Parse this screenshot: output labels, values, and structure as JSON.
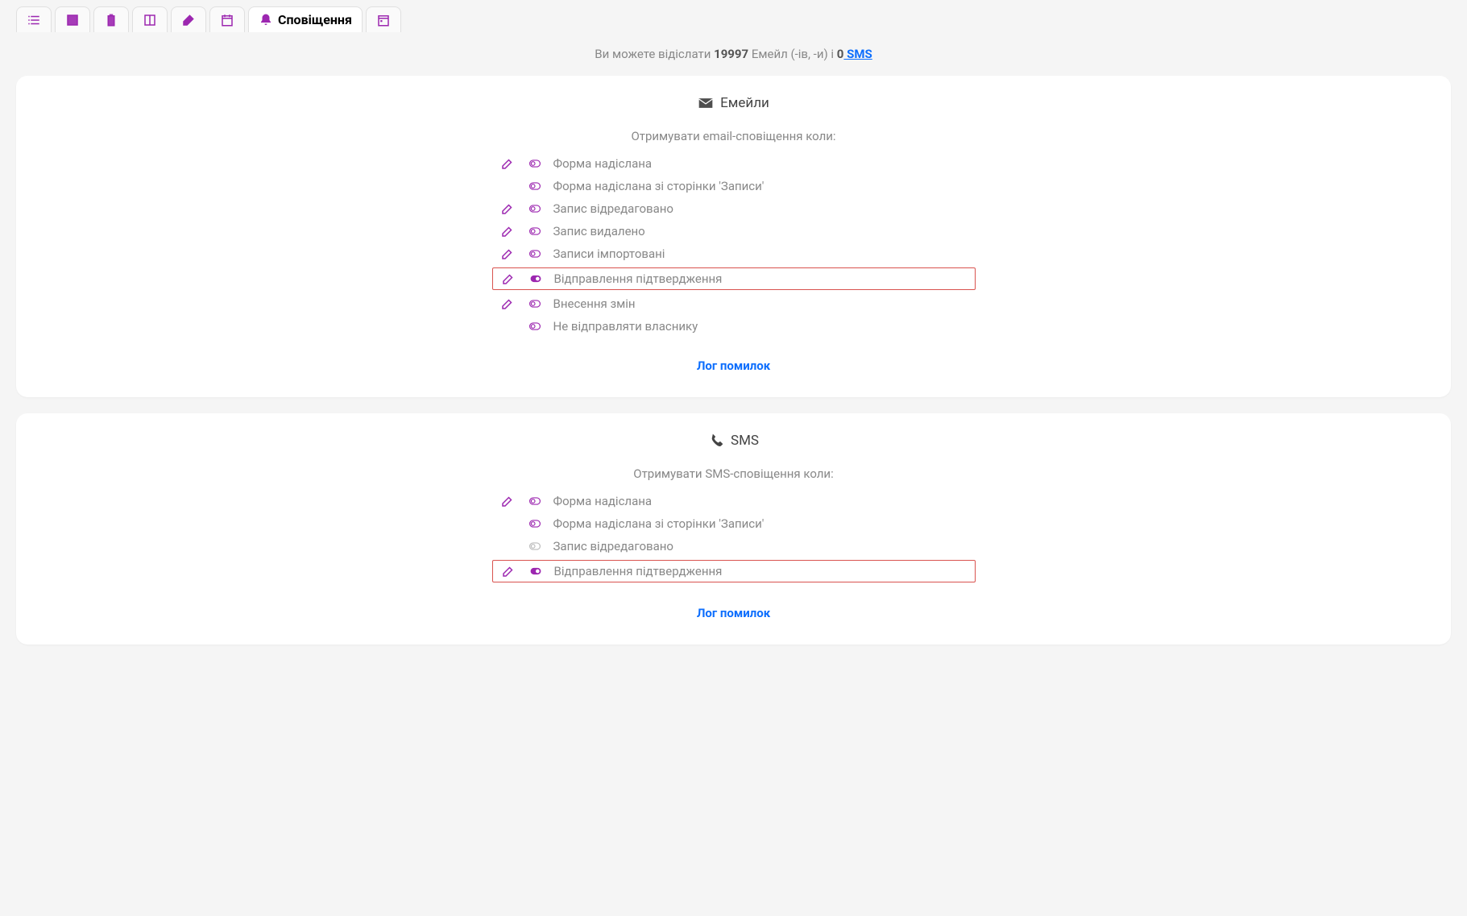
{
  "tabs": {
    "active_index": 6,
    "items": [
      {
        "icon": "list"
      },
      {
        "icon": "window"
      },
      {
        "icon": "clipboard"
      },
      {
        "icon": "columns"
      },
      {
        "icon": "paint"
      },
      {
        "icon": "calendar"
      },
      {
        "icon": "bell",
        "label": "Сповіщення"
      },
      {
        "icon": "date"
      }
    ]
  },
  "quota": {
    "prefix": "Ви можете відіслати ",
    "email_count": "19997",
    "email_label": " Емейл (-ів, -и) і ",
    "sms_count": "0",
    "sms_label": " SMS"
  },
  "email_panel": {
    "title": "Емейли",
    "subtitle": "Отримувати email-сповіщення коли:",
    "rows": [
      {
        "label": "Форма надіслана",
        "edit": true,
        "toggle": "off"
      },
      {
        "label": "Форма надіслана зі сторінки 'Записи'",
        "edit": false,
        "toggle": "off"
      },
      {
        "label": "Запис відредаговано",
        "edit": true,
        "toggle": "off"
      },
      {
        "label": "Запис видалено",
        "edit": true,
        "toggle": "off"
      },
      {
        "label": "Записи імпортовані",
        "edit": true,
        "toggle": "off"
      },
      {
        "label": "Відправлення підтвердження",
        "edit": true,
        "toggle": "on",
        "highlight": true
      },
      {
        "label": "Внесення змін",
        "edit": true,
        "toggle": "off"
      },
      {
        "label": "Не відправляти власнику",
        "edit": false,
        "toggle": "off"
      }
    ],
    "log_link": "Лог помилок"
  },
  "sms_panel": {
    "title": "SMS",
    "subtitle": "Отримувати SMS-сповіщення коли:",
    "rows": [
      {
        "label": "Форма надіслана",
        "edit": true,
        "toggle": "off"
      },
      {
        "label": "Форма надіслана зі сторінки 'Записи'",
        "edit": false,
        "toggle": "off"
      },
      {
        "label": "Запис відредаговано",
        "edit": false,
        "toggle": "disabled"
      },
      {
        "label": "Відправлення підтвердження",
        "edit": true,
        "toggle": "on",
        "highlight": true
      }
    ],
    "log_link": "Лог помилок"
  }
}
